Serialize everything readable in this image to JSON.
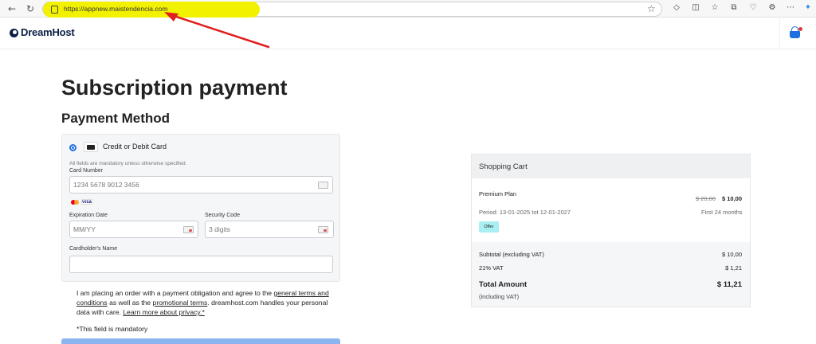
{
  "browser": {
    "url": "https://appnew.maistendencia.com",
    "highlight_color": "#f2f200",
    "annotation_color": "#e02020"
  },
  "site": {
    "logo": "DreamHost",
    "logo_color": "#0b1f44"
  },
  "page": {
    "title": "Subscription payment",
    "section_title": "Payment Method"
  },
  "payment": {
    "method_label": "Credit or Debit Card",
    "selected": true,
    "mandatory_note": "All fields are mandatory unless otherwise specified.",
    "card_number": {
      "label": "Card Number",
      "placeholder": "1234 5678 9012 3456"
    },
    "brands": [
      "mastercard",
      "VISA"
    ],
    "expiration": {
      "label": "Expiration Date",
      "placeholder": "MM/YY"
    },
    "security_code": {
      "label": "Security Code",
      "placeholder": "3 digits"
    },
    "cardholder": {
      "label": "Cardholder's Name",
      "value": ""
    }
  },
  "terms": {
    "t1": "I am placing an order with a payment obligation and agree to the ",
    "link_general": "general terms and conditions",
    "t2": " as well as the ",
    "link_promo": "promotional terms",
    "t3": ". dreamhost.com handles your personal data with care. ",
    "link_privacy": "Learn more about privacy.*",
    "required_note": "*This field is mandatory"
  },
  "cart": {
    "title": "Shopping Cart",
    "item": {
      "name": "Premium Plan",
      "old_price": "$ 20,00",
      "new_price": "$ 10,00",
      "period": "Period: 13-01-2025 tot 12-01-2027",
      "first_months": "First 24 months",
      "badge": "Offer"
    },
    "subtotal_label": "Subtotal (excluding VAT)",
    "subtotal_value": "$ 10,00",
    "vat_label": "21% VAT",
    "vat_value": "$ 1,21",
    "total_label": "Total Amount",
    "total_value": "$ 11,21",
    "total_note": "(including VAT)"
  }
}
